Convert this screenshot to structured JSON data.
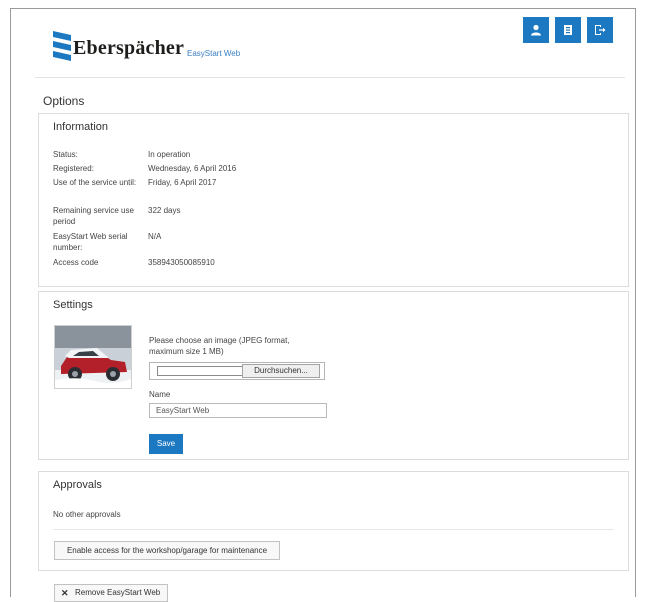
{
  "header": {
    "brand": "Eberspächer",
    "product": "EasyStart Web",
    "icons": [
      "user-icon",
      "book-icon",
      "logout-icon"
    ]
  },
  "options": {
    "title": "Options"
  },
  "information": {
    "title": "Information",
    "rows": [
      {
        "label": "Status:",
        "value": "In operation"
      },
      {
        "label": "Registered:",
        "value": "Wednesday, 6 April 2016"
      },
      {
        "label": "Use of the service until:",
        "value": "Friday, 6 April 2017"
      },
      {
        "label": "Remaining service use period",
        "value": "322 days"
      },
      {
        "label": "EasyStart Web serial number:",
        "value": "N/A"
      },
      {
        "label": "Access code",
        "value": "358943050085910"
      }
    ]
  },
  "settings": {
    "title": "Settings",
    "choose_text": "Please choose an image (JPEG format, maximum size 1 MB)",
    "browse_label": "Durchsuchen...",
    "name_label": "Name",
    "name_value": "EasyStart Web",
    "save_label": "Save"
  },
  "approvals": {
    "title": "Approvals",
    "none_text": "No other approvals",
    "workshop_label": "Enable access for the workshop/garage for maintenance"
  },
  "remove": {
    "label": "Remove EasyStart Web"
  },
  "colors": {
    "accent": "#1c78c0",
    "brand_link": "#3b7fc4",
    "logo": "#1c78c0"
  }
}
